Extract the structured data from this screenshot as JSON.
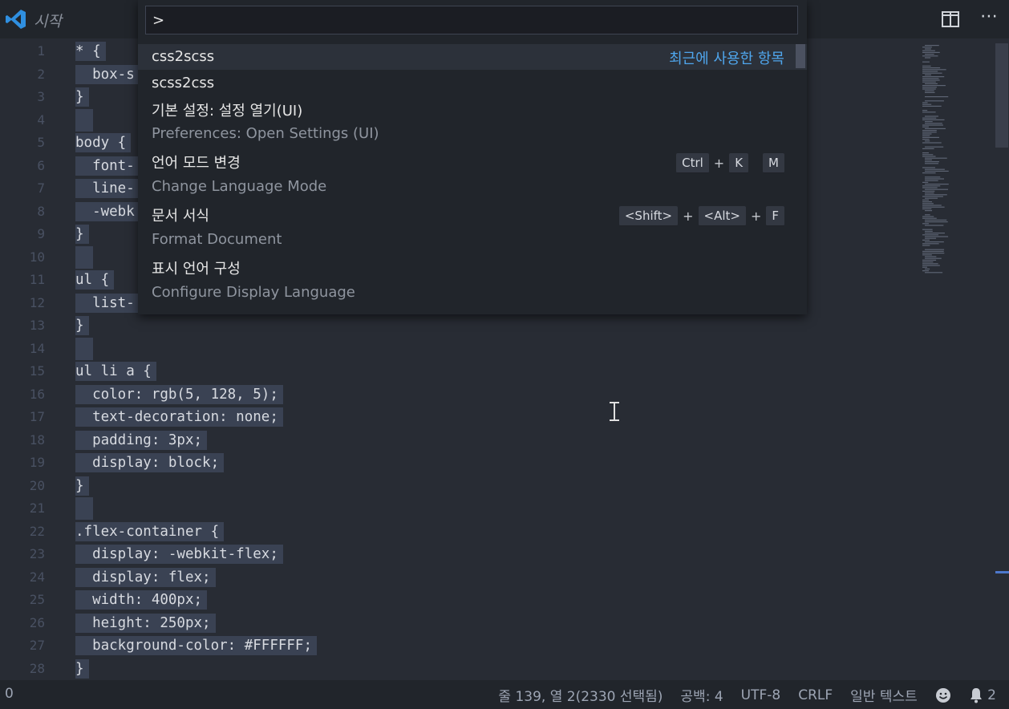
{
  "titlebar": {
    "tab_title": "시작"
  },
  "palette": {
    "input_value": ">",
    "items": [
      {
        "label": "css2scss",
        "detail": "최근에 사용한 항목"
      },
      {
        "label": "scss2css"
      },
      {
        "label": "기본 설정: 설정 열기(UI)",
        "sub": "Preferences: Open Settings (UI)"
      },
      {
        "label": "언어 모드 변경",
        "sub": "Change Language Mode",
        "keys": [
          "Ctrl",
          "+",
          "K",
          "M"
        ]
      },
      {
        "label": "문서 서식",
        "sub": "Format Document",
        "keys": [
          "<Shift>",
          "+",
          "<Alt>",
          "+",
          "F"
        ]
      },
      {
        "label": "표시 언어 구성",
        "sub": "Configure Display Language"
      }
    ]
  },
  "editor": {
    "lines": [
      "* {",
      "  box-s",
      "}",
      "",
      "body {",
      "  font-",
      "  line-",
      "  -webk",
      "}",
      "",
      "ul {",
      "  list-",
      "}",
      "",
      "ul li a {",
      "  color: rgb(5, 128, 5);",
      "  text-decoration: none;",
      "  padding: 3px;",
      "  display: block;",
      "}",
      "",
      ".flex-container {",
      "  display: -webkit-flex;",
      "  display: flex;",
      "  width: 400px;",
      "  height: 250px;",
      "  background-color: #FFFFFF;",
      "}"
    ],
    "line_numbers": [
      "1",
      "2",
      "3",
      "4",
      "5",
      "6",
      "7",
      "8",
      "9",
      "10",
      "11",
      "12",
      "13",
      "14",
      "15",
      "16",
      "17",
      "18",
      "19",
      "20",
      "21",
      "22",
      "23",
      "24",
      "25",
      "26",
      "27",
      "28"
    ]
  },
  "statusbar": {
    "left": "0",
    "position": "줄 139, 열 2(2330 선택됨)",
    "spaces": "공백: 4",
    "encoding": "UTF-8",
    "eol": "CRLF",
    "language": "일반 텍스트",
    "notifications": "2"
  }
}
